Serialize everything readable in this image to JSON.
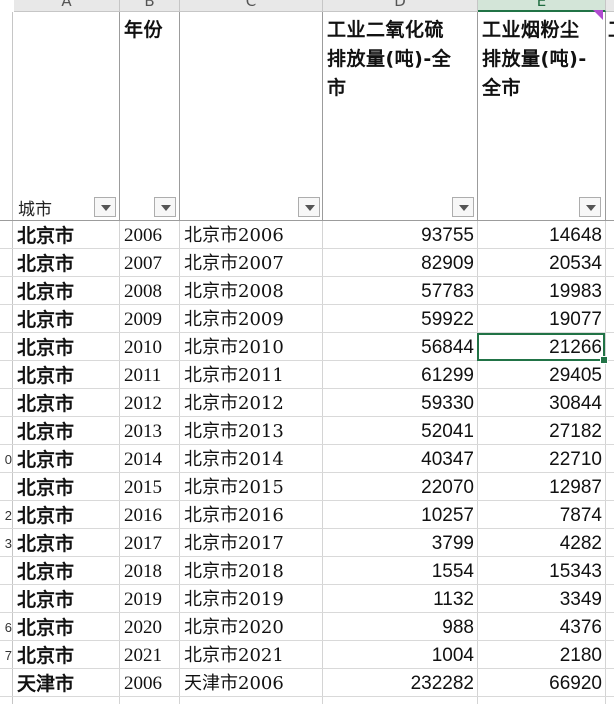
{
  "spreadsheet": {
    "column_letters": [
      "A",
      "B",
      "C",
      "D",
      "E"
    ],
    "selected_column": "E",
    "headers": {
      "city": "城市",
      "year": "年份",
      "key": "",
      "so2_line1": "工业二氧化硫",
      "so2_line2": "排放量(吨)-全",
      "so2_line3": "市",
      "dust_line1": "工业烟粉尘",
      "dust_line2": "排放量(吨)-",
      "dust_line3": "全市",
      "partial_next": "工"
    },
    "filter_icon": "dropdown-filter-icon",
    "active_cell": "E7",
    "rows": [
      {
        "city": "北京市",
        "year": "2006",
        "key": "北京市2006",
        "so2": "93755",
        "dust": "14648"
      },
      {
        "city": "北京市",
        "year": "2007",
        "key": "北京市2007",
        "so2": "82909",
        "dust": "20534"
      },
      {
        "city": "北京市",
        "year": "2008",
        "key": "北京市2008",
        "so2": "57783",
        "dust": "19983"
      },
      {
        "city": "北京市",
        "year": "2009",
        "key": "北京市2009",
        "so2": "59922",
        "dust": "19077"
      },
      {
        "city": "北京市",
        "year": "2010",
        "key": "北京市2010",
        "so2": "56844",
        "dust": "21266"
      },
      {
        "city": "北京市",
        "year": "2011",
        "key": "北京市2011",
        "so2": "61299",
        "dust": "29405"
      },
      {
        "city": "北京市",
        "year": "2012",
        "key": "北京市2012",
        "so2": "59330",
        "dust": "30844"
      },
      {
        "city": "北京市",
        "year": "2013",
        "key": "北京市2013",
        "so2": "52041",
        "dust": "27182"
      },
      {
        "city": "北京市",
        "year": "2014",
        "key": "北京市2014",
        "so2": "40347",
        "dust": "22710"
      },
      {
        "city": "北京市",
        "year": "2015",
        "key": "北京市2015",
        "so2": "22070",
        "dust": "12987"
      },
      {
        "city": "北京市",
        "year": "2016",
        "key": "北京市2016",
        "so2": "10257",
        "dust": "7874"
      },
      {
        "city": "北京市",
        "year": "2017",
        "key": "北京市2017",
        "so2": "3799",
        "dust": "4282"
      },
      {
        "city": "北京市",
        "year": "2018",
        "key": "北京市2018",
        "so2": "1554",
        "dust": "15343"
      },
      {
        "city": "北京市",
        "year": "2019",
        "key": "北京市2019",
        "so2": "1132",
        "dust": "3349"
      },
      {
        "city": "北京市",
        "year": "2020",
        "key": "北京市2020",
        "so2": "988",
        "dust": "4376"
      },
      {
        "city": "北京市",
        "year": "2021",
        "key": "北京市2021",
        "so2": "1004",
        "dust": "2180"
      },
      {
        "city": "天津市",
        "year": "2006",
        "key": "天津市2006",
        "so2": "232282",
        "dust": "66920"
      }
    ],
    "row_numbers": [
      "",
      "",
      "",
      "",
      "",
      "",
      "",
      "",
      "0",
      "",
      "2",
      "3",
      "",
      "",
      "6",
      "7",
      ""
    ],
    "colors": {
      "selection": "#217346",
      "grid": "#d4d4d4",
      "header_bg": "#e8e8e8"
    }
  }
}
